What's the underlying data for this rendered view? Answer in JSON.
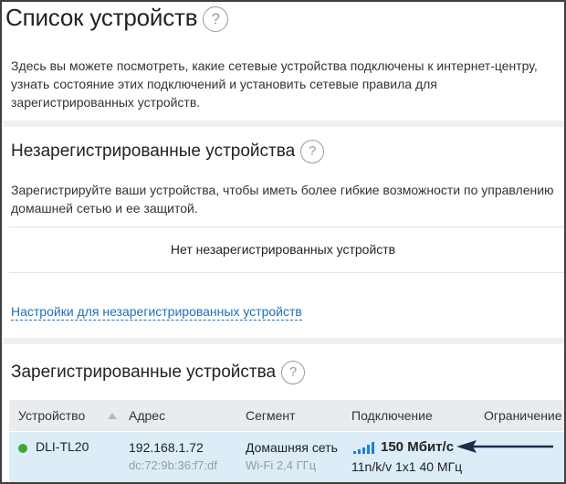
{
  "page": {
    "title": "Список устройств",
    "help": "?",
    "intro_line1": "Здесь вы можете посмотреть, какие сетевые устройства подключены к интернет-центру,",
    "intro_line2": "узнать состояние этих подключений и установить сетевые правила для",
    "intro_line3": "зарегистрированных устройств."
  },
  "unregistered": {
    "title": "Незарегистрированные устройства",
    "desc_line1": "Зарегистрируйте ваши устройства, чтобы иметь более гибкие возможности по управлению",
    "desc_line2": "домашней сетью и ее защитой.",
    "empty_text": "Нет незарегистрированных устройств",
    "settings_link": "Настройки для незарегистрированных устройств"
  },
  "registered": {
    "title": "Зарегистрированные устройства",
    "columns": {
      "device": "Устройство",
      "address": "Адрес",
      "segment": "Сегмент",
      "connection": "Подключение",
      "limit": "Ограничение"
    },
    "rows": [
      {
        "device": "DLI-TL20",
        "status_color": "#3aaa35",
        "ip": "192.168.1.72",
        "mac": "dc:72:9b:36:f7:df",
        "segment": "Домашняя сеть",
        "band": "Wi-Fi 2,4 ГГц",
        "speed": "150 Мбит/с",
        "mode": "11n/k/v 1x1 40 МГц",
        "signal_icon": "signal-bars-icon"
      }
    ]
  },
  "colors": {
    "accent": "#1d6fb8",
    "row_highlight": "#dcedf8",
    "header_bg": "#e9ecee",
    "signal": "#1e7fd6",
    "arrow": "#1c2d4a"
  }
}
